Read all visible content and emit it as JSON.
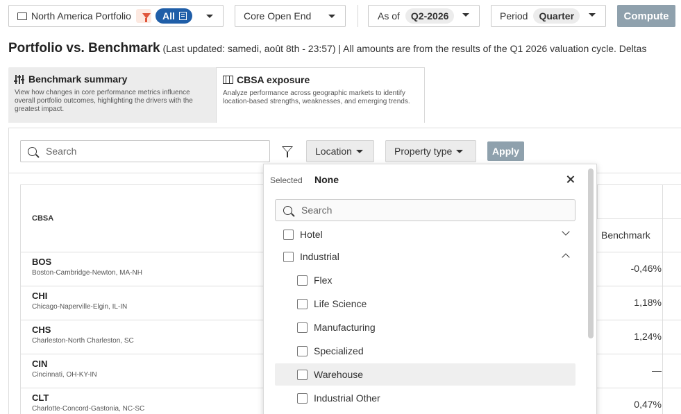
{
  "toolbar": {
    "portfolio_label": "North America Portfolio",
    "all_pill": "All",
    "fund_select": "Core Open End",
    "as_of_label": "As of",
    "as_of_value": "Q2-2026",
    "period_label": "Period",
    "period_value": "Quarter",
    "compute_label": "Compute"
  },
  "header": {
    "title": "Portfolio vs. Benchmark",
    "subtitle": "(Last updated: samedi, août 8th - 23:57) | All amounts are from the results of the Q1 2026 valuation cycle. Deltas"
  },
  "tabs": [
    {
      "title": "Benchmark summary",
      "desc": "View how changes in core performance metrics influence overall portfolio outcomes, highlighting the drivers with the greatest impact.",
      "icon": "sliders-icon",
      "active": false
    },
    {
      "title": "CBSA exposure",
      "desc": "Analyze performance across geographic markets to identify location-based strengths, weaknesses, and emerging trends.",
      "icon": "map-icon",
      "active": true
    }
  ],
  "filters": {
    "search_placeholder": "Search",
    "location_label": "Location",
    "property_type_label": "Property type",
    "apply_label": "Apply"
  },
  "table": {
    "col_cbsa": "CBSA",
    "col_benchmark": "Benchmark",
    "rows": [
      {
        "code": "BOS",
        "name": "Boston-Cambridge-Newton, MA-NH",
        "benchmark": "-0,46%"
      },
      {
        "code": "CHI",
        "name": "Chicago-Naperville-Elgin, IL-IN",
        "benchmark": "1,18%"
      },
      {
        "code": "CHS",
        "name": "Charleston-North Charleston, SC",
        "benchmark": "1,24%"
      },
      {
        "code": "CIN",
        "name": "Cincinnati, OH-KY-IN",
        "benchmark": "—"
      },
      {
        "code": "CLT",
        "name": "Charlotte-Concord-Gastonia, NC-SC",
        "benchmark": "0,47%"
      }
    ]
  },
  "dropdown": {
    "selected_label": "Selected",
    "selected_value": "None",
    "search_placeholder": "Search",
    "options": [
      {
        "label": "Hotel",
        "level": 1,
        "expanded": false
      },
      {
        "label": "Industrial",
        "level": 1,
        "expanded": true
      },
      {
        "label": "Flex",
        "level": 2
      },
      {
        "label": "Life Science",
        "level": 2
      },
      {
        "label": "Manufacturing",
        "level": 2
      },
      {
        "label": "Specialized",
        "level": 2
      },
      {
        "label": "Warehouse",
        "level": 2,
        "hover": true
      },
      {
        "label": "Industrial Other",
        "level": 2
      }
    ]
  },
  "colors": {
    "accent_blue": "#1f5ea8",
    "filter_orange": "#e0553a",
    "disabled_button": "#8fa1ad"
  }
}
